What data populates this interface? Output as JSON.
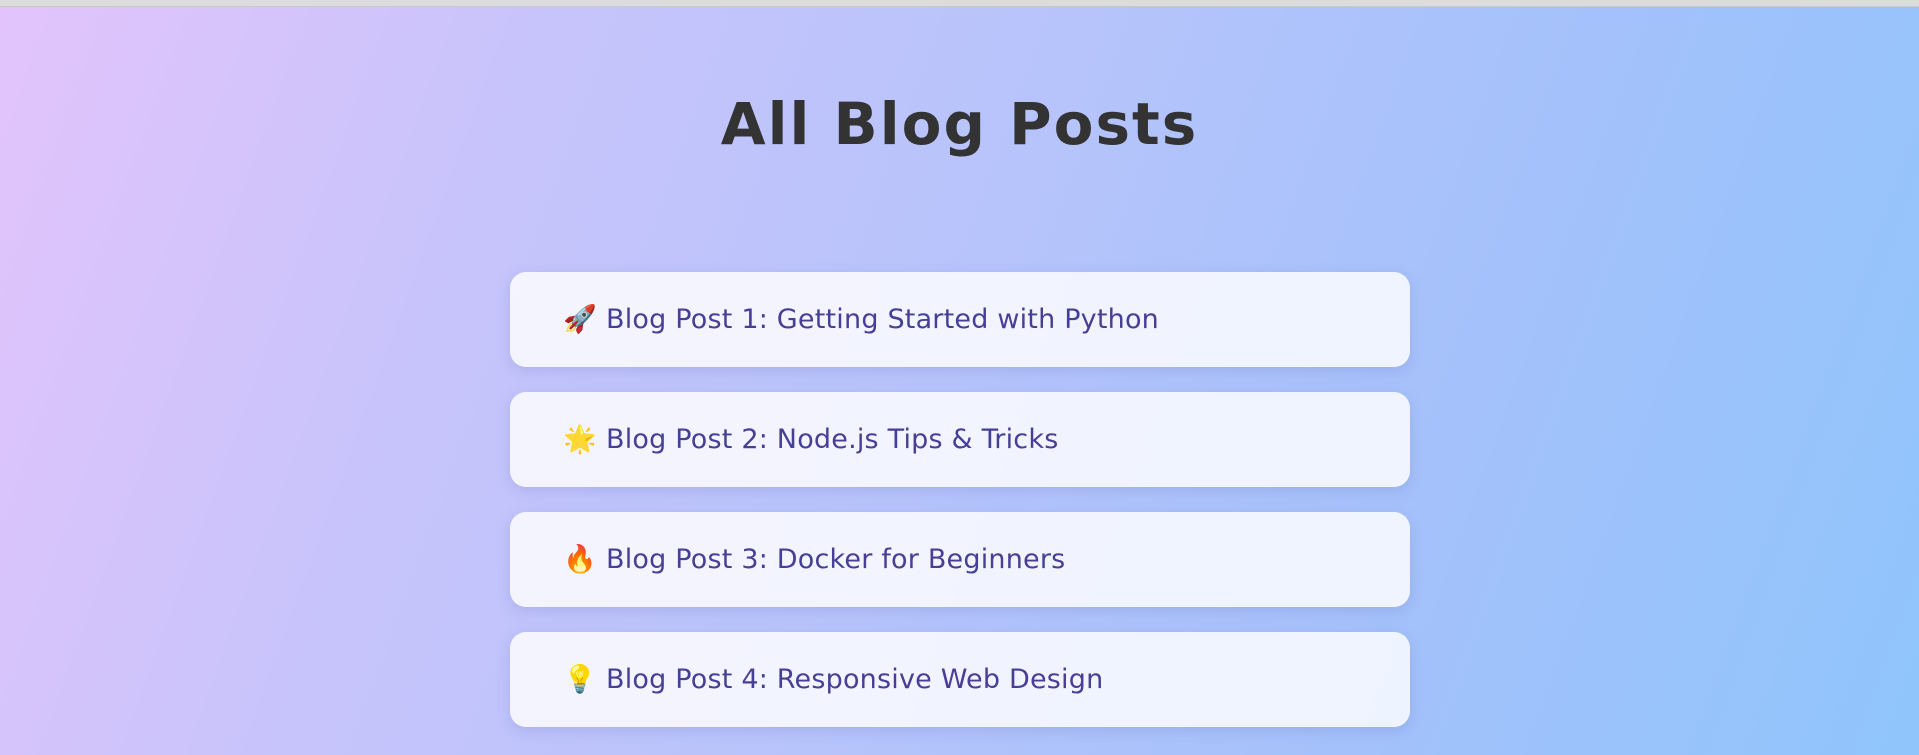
{
  "page": {
    "title": "All Blog Posts"
  },
  "posts": [
    {
      "icon": "rocket-icon",
      "emoji": "🚀",
      "title": "Blog Post 1: Getting Started with Python"
    },
    {
      "icon": "glowing-star-icon",
      "emoji": "🌟",
      "title": "Blog Post 2: Node.js Tips & Tricks"
    },
    {
      "icon": "fire-icon",
      "emoji": "🔥",
      "title": "Blog Post 3: Docker for Beginners"
    },
    {
      "icon": "lightbulb-icon",
      "emoji": "💡",
      "title": "Blog Post 4: Responsive Web Design"
    }
  ],
  "colors": {
    "title": "#333333",
    "post_text": "#453f96",
    "card_bg": "#f2f3fb"
  }
}
